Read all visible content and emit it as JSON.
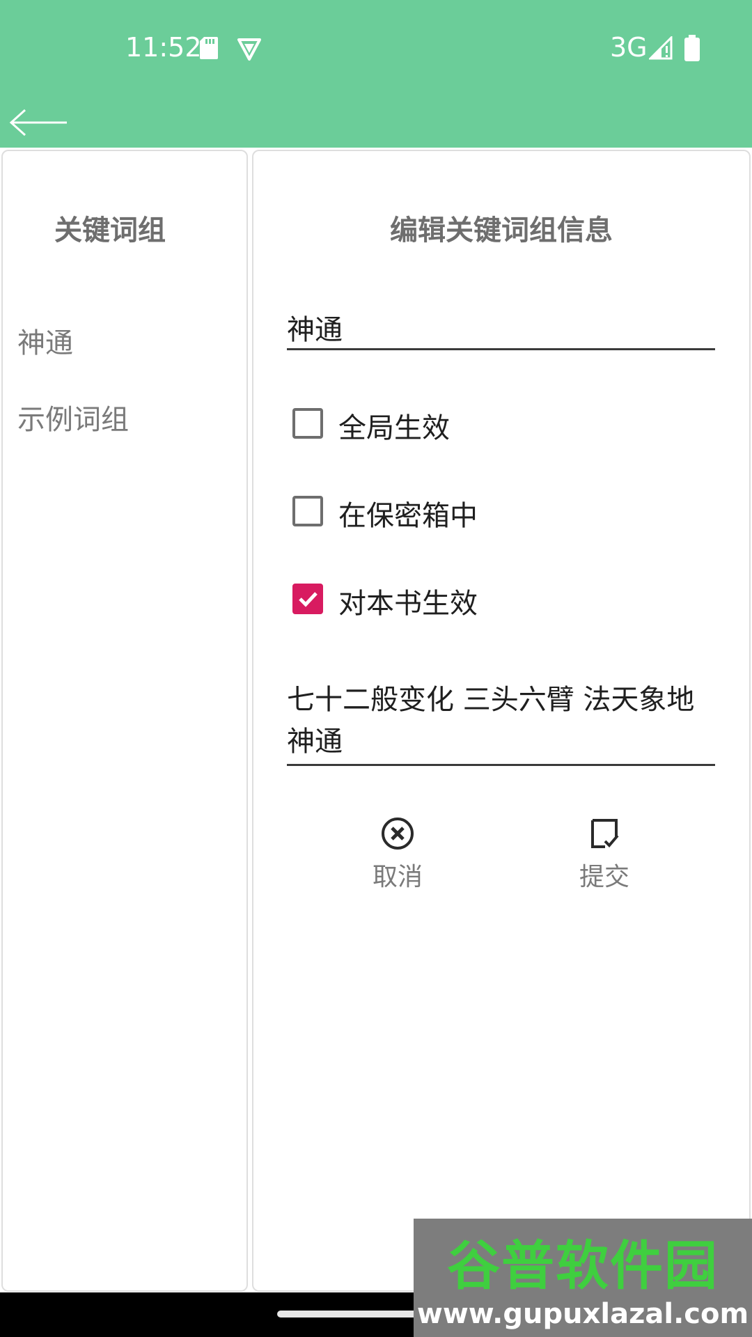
{
  "status_bar": {
    "time": "11:52",
    "network": "3G",
    "icons": [
      "sd-card-icon",
      "vpn-icon",
      "signal-icon",
      "battery-icon"
    ]
  },
  "app_bar": {
    "back_icon": "arrow-left-icon",
    "color": "#6bcd99"
  },
  "sidebar": {
    "title": "关键词组",
    "items": [
      {
        "label": "神通"
      },
      {
        "label": "示例词组"
      }
    ]
  },
  "editor": {
    "title": "编辑关键词组信息",
    "name_value": "神通",
    "options": [
      {
        "label": "全局生效",
        "checked": false
      },
      {
        "label": "在保密箱中",
        "checked": false
      },
      {
        "label": "对本书生效",
        "checked": true
      }
    ],
    "keywords_value": "七十二般变化 三头六臂 法天象地 神通",
    "cancel_label": "取消",
    "submit_label": "提交",
    "accent_color": "#d81b60"
  },
  "watermark": {
    "main": "谷普软件园",
    "url": "www.gupuxlazal.com"
  }
}
